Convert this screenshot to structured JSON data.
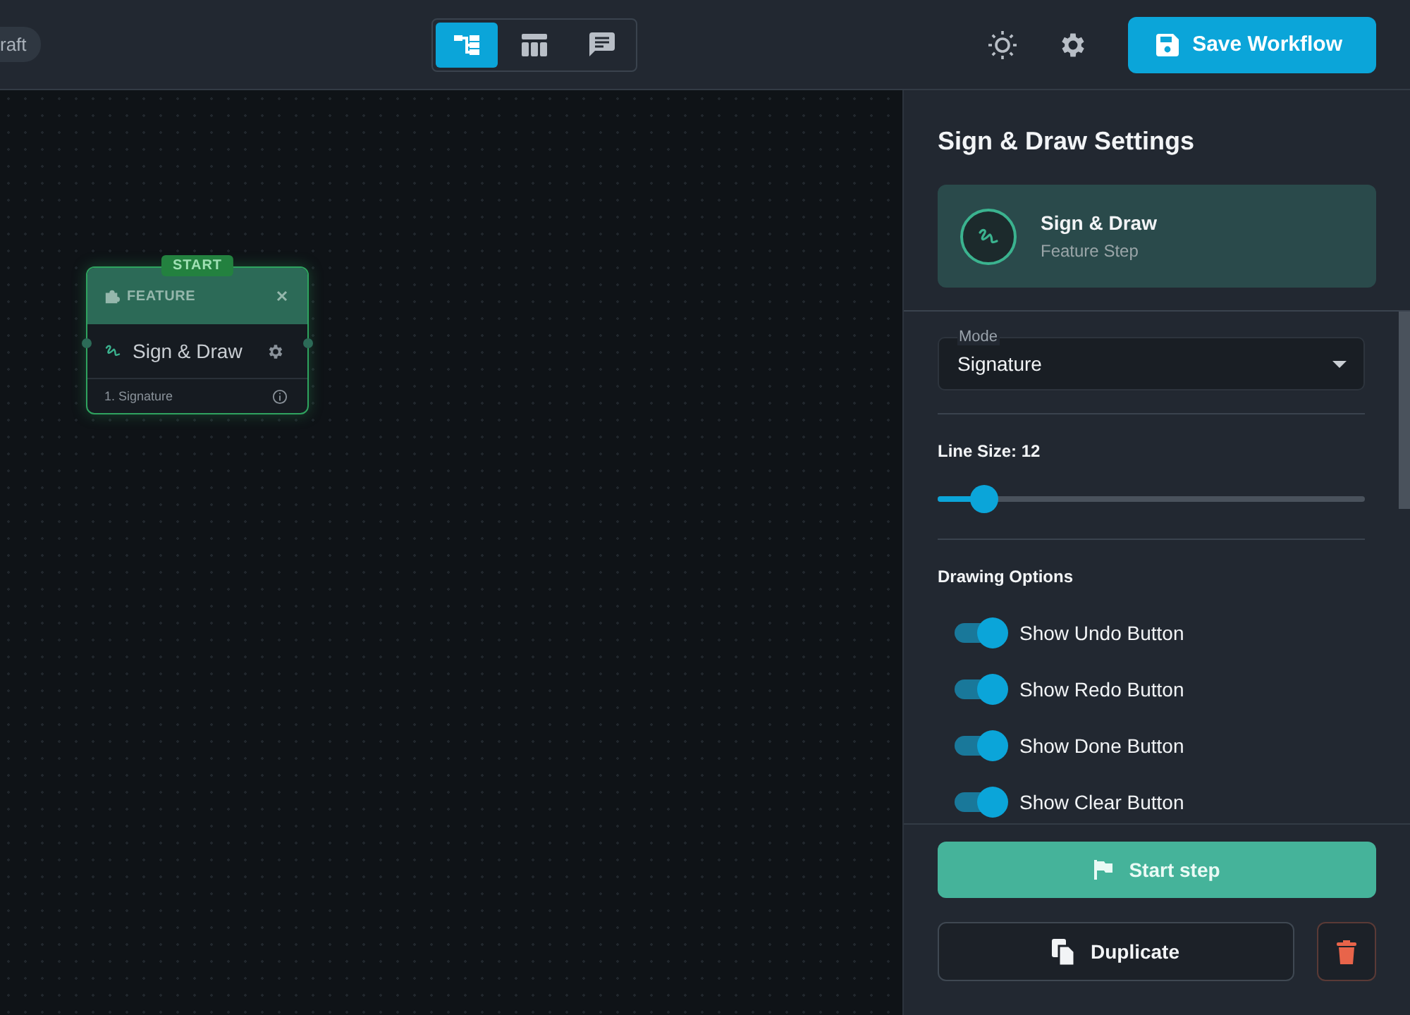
{
  "topbar": {
    "status_chip": "raft",
    "view_tabs": [
      {
        "kind": "flow",
        "selected": true
      },
      {
        "kind": "table",
        "selected": false
      },
      {
        "kind": "chat",
        "selected": false
      }
    ],
    "save_button": "Save Workflow"
  },
  "canvas": {
    "node": {
      "badge": "START",
      "category": "FEATURE",
      "title": "Sign & Draw",
      "field": "1. Signature"
    }
  },
  "panel": {
    "title": "Sign & Draw Settings",
    "step": {
      "name": "Sign & Draw",
      "type": "Feature Step"
    },
    "mode": {
      "label": "Mode",
      "value": "Signature"
    },
    "line_size": {
      "label": "Line Size: 12",
      "level": 0.11
    },
    "section": "Drawing Options",
    "options": [
      {
        "label": "Show Undo Button",
        "on": true
      },
      {
        "label": "Show Redo Button",
        "on": true
      },
      {
        "label": "Show Done Button",
        "on": true
      },
      {
        "label": "Show Clear Button",
        "on": true
      }
    ],
    "start_button": "Start step",
    "duplicate_button": "Duplicate"
  }
}
